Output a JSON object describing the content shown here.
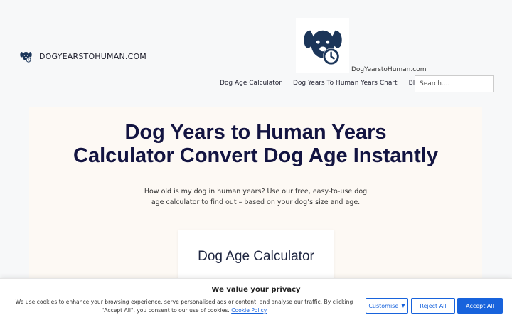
{
  "header": {
    "site_title": "DOGYEARSTOHUMAN.COM",
    "logo_caption": "DogYearstoHuman.com"
  },
  "nav": {
    "items": [
      {
        "label": "Dog Age Calculator"
      },
      {
        "label": "Dog Years To Human Years Chart"
      },
      {
        "label": "Blog"
      }
    ],
    "search_placeholder": "Search...."
  },
  "hero": {
    "title_line1": "Dog Years to Human Years",
    "title_line2": "Calculator Convert Dog Age Instantly",
    "subtitle": "How old is my dog in human years? Use our free, easy-to-use dog age calculator to find out – based on your dog’s size and age."
  },
  "calculator": {
    "title": "Dog Age Calculator"
  },
  "cookie": {
    "title": "We value your privacy",
    "text": "We use cookies to enhance your browsing experience, serve personalised ads or content, and analyse our traffic. By clicking \"Accept All\", you consent to our use of cookies.",
    "policy_link": "Cookie Policy",
    "customise_label": "Customise",
    "reject_label": "Reject All",
    "accept_label": "Accept All"
  },
  "colors": {
    "brand_navy": "#131441",
    "accent_blue": "#1863dc",
    "hero_bg": "#fdf9f4"
  }
}
